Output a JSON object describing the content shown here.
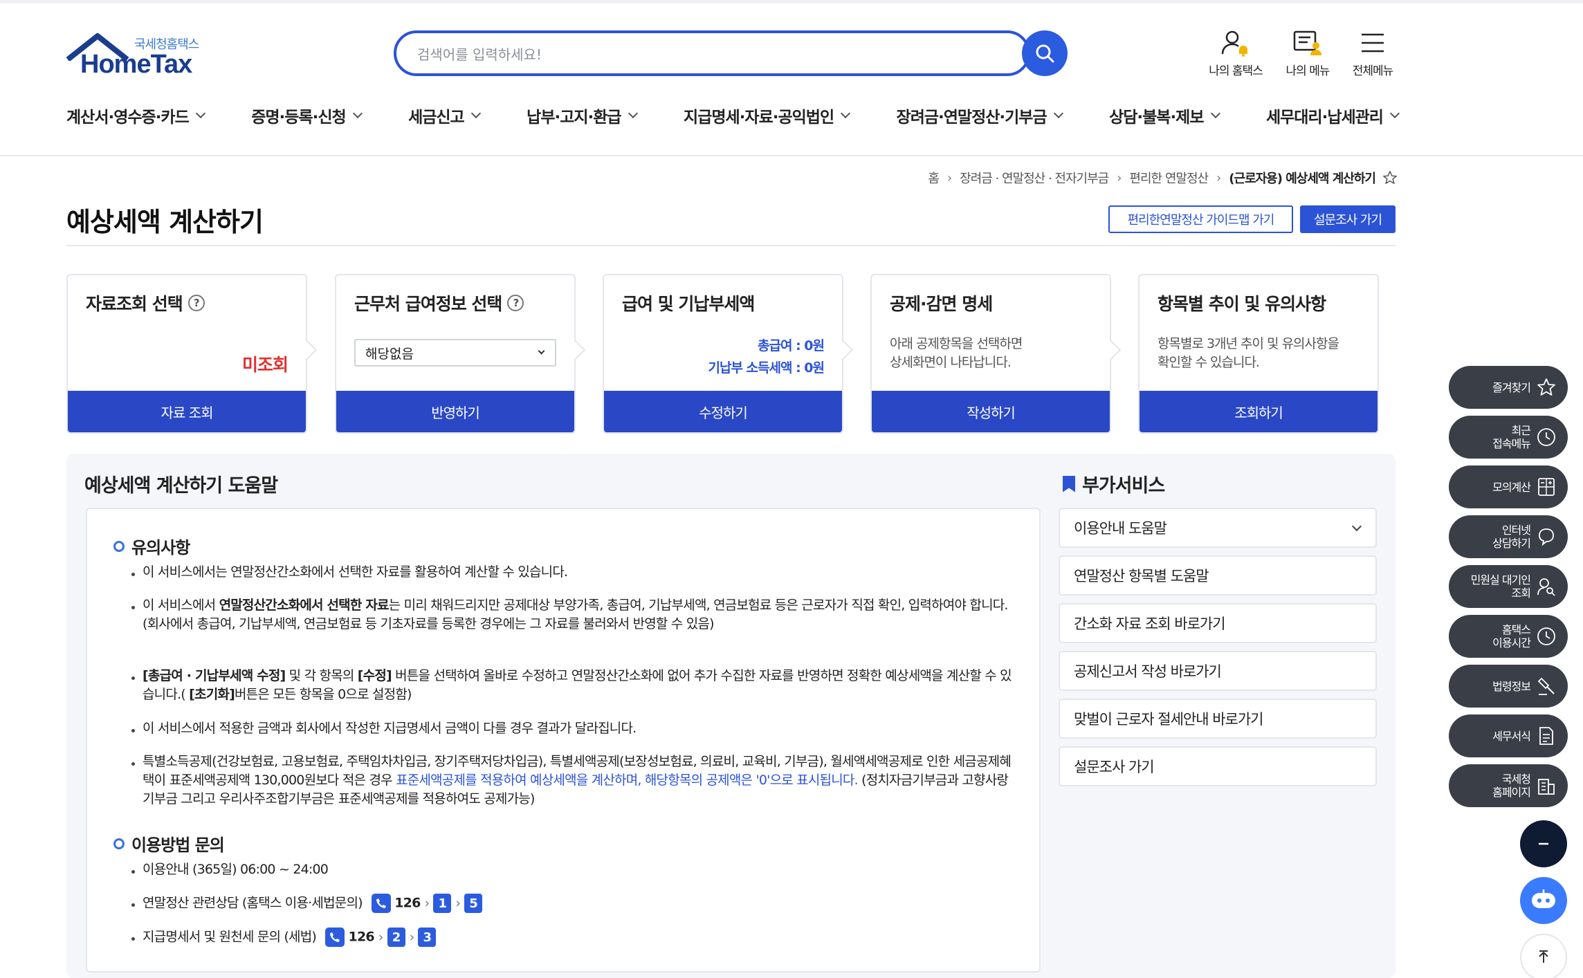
{
  "header": {
    "logo_sub": "국세청홈택스",
    "logo_main": "HomeTax",
    "search_placeholder": "검색어를 입력하세요!",
    "icons": [
      {
        "label": "나의 홈택스",
        "icon": "user-bell-icon"
      },
      {
        "label": "나의 메뉴",
        "icon": "my-menu-icon"
      },
      {
        "label": "전체메뉴",
        "icon": "hamburger-icon"
      }
    ]
  },
  "gnb": [
    "계산서·영수증·카드",
    "증명·등록·신청",
    "세금신고",
    "납부·고지·환급",
    "지급명세·자료·공익법인",
    "장려금·연말정산·기부금",
    "상담·불복·제보",
    "세무대리·납세관리"
  ],
  "breadcrumb": [
    "홈",
    "장려금 · 연말정산 · 전자기부금",
    "편리한 연말정산",
    "(근로자용) 예상세액 계산하기"
  ],
  "page_title": "예상세액 계산하기",
  "buttons": {
    "guide": "편리한연말정산 가이드맵 가기",
    "survey": "설문조사 가기"
  },
  "steps": [
    {
      "title": "자료조회 선택",
      "status": "미조회",
      "button": "자료 조회"
    },
    {
      "title": "근무처 급여정보 선택",
      "select_value": "해당없음",
      "button": "반영하기"
    },
    {
      "title": "급여 및 기납부세액",
      "line1": "총급여 : 0원",
      "line2": "기납부 소득세액 : 0원",
      "button": "수정하기"
    },
    {
      "title": "공제·감면 명세",
      "desc1": "아래 공제항목을 선택하면",
      "desc2": "상세화면이 나타납니다.",
      "button": "작성하기"
    },
    {
      "title": "항목별 추이 및 유의사항",
      "desc1": "항목별로 3개년 추이 및 유의사항을",
      "desc2": "확인할 수 있습니다.",
      "button": "조회하기"
    }
  ],
  "help": {
    "title": "예상세액 계산하기 도움말",
    "notes_heading": "유의사항",
    "n1": "이 서비스에서는 연말정산간소화에서 선택한 자료를 활용하여 계산할 수 있습니다.",
    "n2a": "이 서비스에서 ",
    "n2b": "연말정산간소화에서 선택한 자료",
    "n2c": "는 미리 채워드리지만 공제대상 부양가족, 총급여, 기납부세액, 연금보험료 등은 근로자가 직접 확인, 입력하여야 합니다.",
    "n2d": "(회사에서 총급여, 기납부세액, 연금보험료 등 기초자료를 등록한 경우에는 그 자료를 불러와서 반영할 수 있음)",
    "n3a": "[총급여 · 기납부세액 수정]",
    "n3b": " 및 각 항목의 ",
    "n3c": "[수정]",
    "n3d": " 버튼을 선택하여 올바로 수정하고 연말정산간소화에 없어 추가 수집한 자료를 반영하면 정확한 예상세액을 계산할 수 있습니다.( ",
    "n3e": "[초기화]",
    "n3f": "버튼은 모든 항목을 0으로 설정함)",
    "n4": "이 서비스에서 적용한 금액과 회사에서 작성한 지급명세서 금액이 다를 경우 결과가 달라집니다.",
    "n5a": "특별소득공제(건강보험료, 고용보험료, 주택임차차입금, 장기주택저당차입금), 특별세액공제(보장성보험료, 의료비, 교육비, 기부금), 월세액세액공제로 인한 세금공제혜택이 표준세액공제액 130,000원보다 적은 경우 ",
    "n5b": "표준세액공제를 적용하여 예상세액을 계산하며, 해당항목의 공제액은 '0'으로 표시됩니다.",
    "n5c": " (정치자금기부금과 고향사랑기부금 그리고 우리사주조합기부금은 표준세액공제를 적용하여도 공제가능)",
    "usage_heading": "이용방법 문의",
    "u1": "이용안내 (365일) 06:00 ~ 24:00",
    "u2": "연말정산 관련상담 (홈택스 이용·세법문의)",
    "u2_num": "126",
    "u2_keys": [
      "1",
      "5"
    ],
    "u3": "지급명세서 및 원천세 문의 (세법)",
    "u3_num": "126",
    "u3_keys": [
      "2",
      "3"
    ]
  },
  "services": {
    "title": "부가서비스",
    "items": [
      "이용안내 도움말",
      "연말정산 항목별 도움말",
      "간소화 자료 조회 바로가기",
      "공제신고서 작성 바로가기",
      "맞벌이 근로자 절세안내 바로가기",
      "설문조사 가기"
    ]
  },
  "quick_menu": [
    {
      "l1": "즐겨찾기",
      "l2": "",
      "icon": "star-icon"
    },
    {
      "l1": "최근",
      "l2": "접속메뉴",
      "icon": "clock-icon"
    },
    {
      "l1": "모의계산",
      "l2": "",
      "icon": "calculator-icon"
    },
    {
      "l1": "인터넷",
      "l2": "상담하기",
      "icon": "chat-icon"
    },
    {
      "l1": "민원실 대기인",
      "l2": "조회",
      "icon": "person-search-icon"
    },
    {
      "l1": "홈택스",
      "l2": "이용시간",
      "icon": "clock-icon"
    },
    {
      "l1": "법령정보",
      "l2": "",
      "icon": "law-icon"
    },
    {
      "l1": "세무서식",
      "l2": "",
      "icon": "form-icon"
    },
    {
      "l1": "국세청",
      "l2": "홈페이지",
      "icon": "building-icon"
    }
  ],
  "colors": {
    "primary": "#2a48c6",
    "accent": "#2b53d6",
    "alert": "#e0322f",
    "dark": "#3a3f47",
    "navy": "#0f1b33"
  }
}
